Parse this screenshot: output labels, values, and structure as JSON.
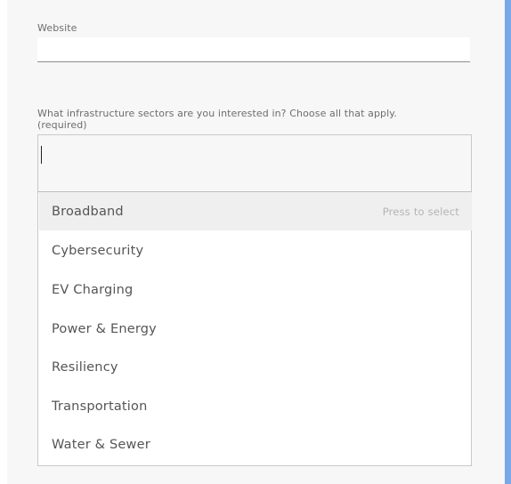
{
  "form": {
    "website_label": "Website",
    "website_value": "",
    "question_label": "What infrastructure sectors are you interested in? Choose all that apply.",
    "question_required": "(required)",
    "search_value": ""
  },
  "dropdown": {
    "hint": "Press to select",
    "options": [
      {
        "label": "Broadband",
        "highlighted": true
      },
      {
        "label": "Cybersecurity",
        "highlighted": false
      },
      {
        "label": "EV Charging",
        "highlighted": false
      },
      {
        "label": "Power & Energy",
        "highlighted": false
      },
      {
        "label": "Resiliency",
        "highlighted": false
      },
      {
        "label": "Transportation",
        "highlighted": false
      },
      {
        "label": "Water & Sewer",
        "highlighted": false
      }
    ]
  },
  "colors": {
    "accent": "#7aa7e8",
    "highlight_row": "#efefef",
    "panel_background": "#f7f7f7"
  }
}
